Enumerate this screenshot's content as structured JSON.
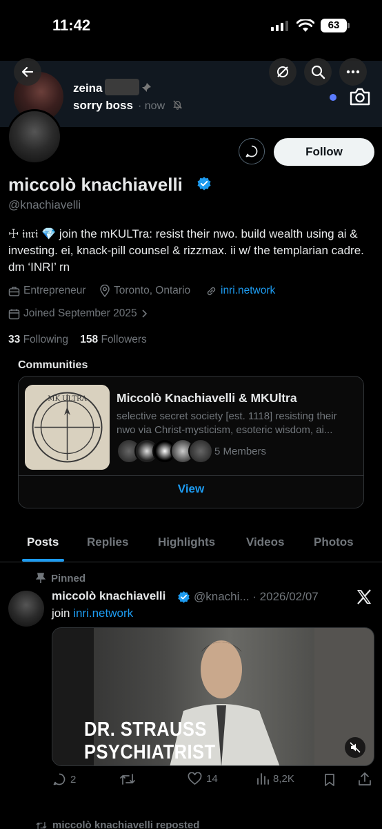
{
  "status": {
    "time": "11:42",
    "battery": "63"
  },
  "chat_preview": {
    "name": "zeina",
    "message": "sorry boss",
    "time": "· now"
  },
  "profile": {
    "display_name": "miccolò knachiavelli",
    "handle": "@knachiavelli",
    "bio_prefix": "☩ 𝔦𝔫𝔯𝔦 💎",
    "bio": "join the mKULTra: resist their nwo. build wealth using ai & investing. ei, knack-pill counsel & rizzmax. ii w/ the templarian cadre. dm ‘INRI’ rn",
    "category": "Entrepreneur",
    "location": "Toronto, Ontario",
    "website": "inri.network",
    "joined": "Joined September 2025",
    "following_count": "33",
    "following_label": "Following",
    "followers_count": "158",
    "followers_label": "Followers",
    "follow_label": "Follow"
  },
  "communities": {
    "title": "Communities",
    "name": "Miccolò Knachiavelli & MKUltra",
    "description": "selective secret society [est. 1118] resisting their nwo via Christ-mysticism, esoteric wisdom, ai...",
    "members": "5 Members",
    "view_label": "View",
    "seal_text": "MK ULTRA"
  },
  "tabs": [
    "Posts",
    "Replies",
    "Highlights",
    "Videos",
    "Photos"
  ],
  "post": {
    "pinned_label": "Pinned",
    "author": "miccolò knachiavelli",
    "handle_date": "@knachi... · 2026/02/07",
    "text_prefix": "join",
    "link": "inri.network",
    "media_caption_line1": "DR. STRAUSS",
    "media_caption_line2": "PSYCHIATRIST",
    "replies": "2",
    "likes": "14",
    "views": "8,2K"
  },
  "next_item": {
    "reposted": "miccolò knachiavelli reposted"
  },
  "colors": {
    "accent": "#1d9bf0",
    "background": "#000000",
    "muted": "#71767b"
  }
}
